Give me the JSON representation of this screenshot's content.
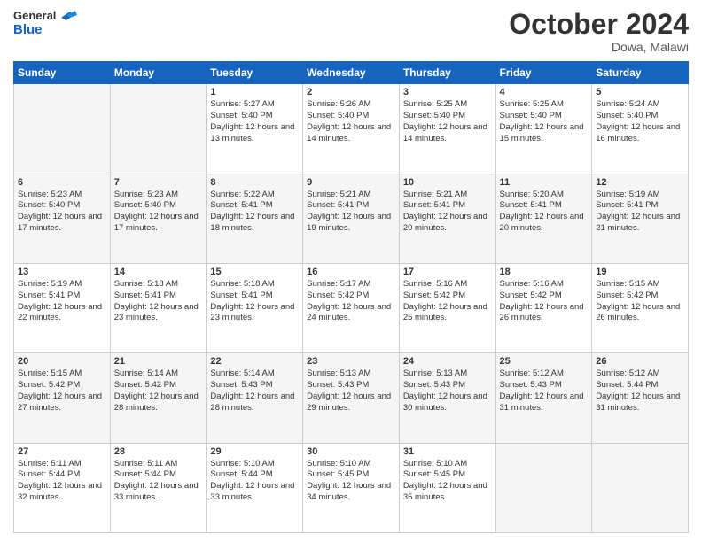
{
  "header": {
    "logo_line1": "General",
    "logo_line2": "Blue",
    "month_title": "October 2024",
    "location": "Dowa, Malawi"
  },
  "weekdays": [
    "Sunday",
    "Monday",
    "Tuesday",
    "Wednesday",
    "Thursday",
    "Friday",
    "Saturday"
  ],
  "weeks": [
    [
      {
        "day": "",
        "sunrise": "",
        "sunset": "",
        "daylight": ""
      },
      {
        "day": "",
        "sunrise": "",
        "sunset": "",
        "daylight": ""
      },
      {
        "day": "1",
        "sunrise": "Sunrise: 5:27 AM",
        "sunset": "Sunset: 5:40 PM",
        "daylight": "Daylight: 12 hours and 13 minutes."
      },
      {
        "day": "2",
        "sunrise": "Sunrise: 5:26 AM",
        "sunset": "Sunset: 5:40 PM",
        "daylight": "Daylight: 12 hours and 14 minutes."
      },
      {
        "day": "3",
        "sunrise": "Sunrise: 5:25 AM",
        "sunset": "Sunset: 5:40 PM",
        "daylight": "Daylight: 12 hours and 14 minutes."
      },
      {
        "day": "4",
        "sunrise": "Sunrise: 5:25 AM",
        "sunset": "Sunset: 5:40 PM",
        "daylight": "Daylight: 12 hours and 15 minutes."
      },
      {
        "day": "5",
        "sunrise": "Sunrise: 5:24 AM",
        "sunset": "Sunset: 5:40 PM",
        "daylight": "Daylight: 12 hours and 16 minutes."
      }
    ],
    [
      {
        "day": "6",
        "sunrise": "Sunrise: 5:23 AM",
        "sunset": "Sunset: 5:40 PM",
        "daylight": "Daylight: 12 hours and 17 minutes."
      },
      {
        "day": "7",
        "sunrise": "Sunrise: 5:23 AM",
        "sunset": "Sunset: 5:40 PM",
        "daylight": "Daylight: 12 hours and 17 minutes."
      },
      {
        "day": "8",
        "sunrise": "Sunrise: 5:22 AM",
        "sunset": "Sunset: 5:41 PM",
        "daylight": "Daylight: 12 hours and 18 minutes."
      },
      {
        "day": "9",
        "sunrise": "Sunrise: 5:21 AM",
        "sunset": "Sunset: 5:41 PM",
        "daylight": "Daylight: 12 hours and 19 minutes."
      },
      {
        "day": "10",
        "sunrise": "Sunrise: 5:21 AM",
        "sunset": "Sunset: 5:41 PM",
        "daylight": "Daylight: 12 hours and 20 minutes."
      },
      {
        "day": "11",
        "sunrise": "Sunrise: 5:20 AM",
        "sunset": "Sunset: 5:41 PM",
        "daylight": "Daylight: 12 hours and 20 minutes."
      },
      {
        "day": "12",
        "sunrise": "Sunrise: 5:19 AM",
        "sunset": "Sunset: 5:41 PM",
        "daylight": "Daylight: 12 hours and 21 minutes."
      }
    ],
    [
      {
        "day": "13",
        "sunrise": "Sunrise: 5:19 AM",
        "sunset": "Sunset: 5:41 PM",
        "daylight": "Daylight: 12 hours and 22 minutes."
      },
      {
        "day": "14",
        "sunrise": "Sunrise: 5:18 AM",
        "sunset": "Sunset: 5:41 PM",
        "daylight": "Daylight: 12 hours and 23 minutes."
      },
      {
        "day": "15",
        "sunrise": "Sunrise: 5:18 AM",
        "sunset": "Sunset: 5:41 PM",
        "daylight": "Daylight: 12 hours and 23 minutes."
      },
      {
        "day": "16",
        "sunrise": "Sunrise: 5:17 AM",
        "sunset": "Sunset: 5:42 PM",
        "daylight": "Daylight: 12 hours and 24 minutes."
      },
      {
        "day": "17",
        "sunrise": "Sunrise: 5:16 AM",
        "sunset": "Sunset: 5:42 PM",
        "daylight": "Daylight: 12 hours and 25 minutes."
      },
      {
        "day": "18",
        "sunrise": "Sunrise: 5:16 AM",
        "sunset": "Sunset: 5:42 PM",
        "daylight": "Daylight: 12 hours and 26 minutes."
      },
      {
        "day": "19",
        "sunrise": "Sunrise: 5:15 AM",
        "sunset": "Sunset: 5:42 PM",
        "daylight": "Daylight: 12 hours and 26 minutes."
      }
    ],
    [
      {
        "day": "20",
        "sunrise": "Sunrise: 5:15 AM",
        "sunset": "Sunset: 5:42 PM",
        "daylight": "Daylight: 12 hours and 27 minutes."
      },
      {
        "day": "21",
        "sunrise": "Sunrise: 5:14 AM",
        "sunset": "Sunset: 5:42 PM",
        "daylight": "Daylight: 12 hours and 28 minutes."
      },
      {
        "day": "22",
        "sunrise": "Sunrise: 5:14 AM",
        "sunset": "Sunset: 5:43 PM",
        "daylight": "Daylight: 12 hours and 28 minutes."
      },
      {
        "day": "23",
        "sunrise": "Sunrise: 5:13 AM",
        "sunset": "Sunset: 5:43 PM",
        "daylight": "Daylight: 12 hours and 29 minutes."
      },
      {
        "day": "24",
        "sunrise": "Sunrise: 5:13 AM",
        "sunset": "Sunset: 5:43 PM",
        "daylight": "Daylight: 12 hours and 30 minutes."
      },
      {
        "day": "25",
        "sunrise": "Sunrise: 5:12 AM",
        "sunset": "Sunset: 5:43 PM",
        "daylight": "Daylight: 12 hours and 31 minutes."
      },
      {
        "day": "26",
        "sunrise": "Sunrise: 5:12 AM",
        "sunset": "Sunset: 5:44 PM",
        "daylight": "Daylight: 12 hours and 31 minutes."
      }
    ],
    [
      {
        "day": "27",
        "sunrise": "Sunrise: 5:11 AM",
        "sunset": "Sunset: 5:44 PM",
        "daylight": "Daylight: 12 hours and 32 minutes."
      },
      {
        "day": "28",
        "sunrise": "Sunrise: 5:11 AM",
        "sunset": "Sunset: 5:44 PM",
        "daylight": "Daylight: 12 hours and 33 minutes."
      },
      {
        "day": "29",
        "sunrise": "Sunrise: 5:10 AM",
        "sunset": "Sunset: 5:44 PM",
        "daylight": "Daylight: 12 hours and 33 minutes."
      },
      {
        "day": "30",
        "sunrise": "Sunrise: 5:10 AM",
        "sunset": "Sunset: 5:45 PM",
        "daylight": "Daylight: 12 hours and 34 minutes."
      },
      {
        "day": "31",
        "sunrise": "Sunrise: 5:10 AM",
        "sunset": "Sunset: 5:45 PM",
        "daylight": "Daylight: 12 hours and 35 minutes."
      },
      {
        "day": "",
        "sunrise": "",
        "sunset": "",
        "daylight": ""
      },
      {
        "day": "",
        "sunrise": "",
        "sunset": "",
        "daylight": ""
      }
    ]
  ]
}
